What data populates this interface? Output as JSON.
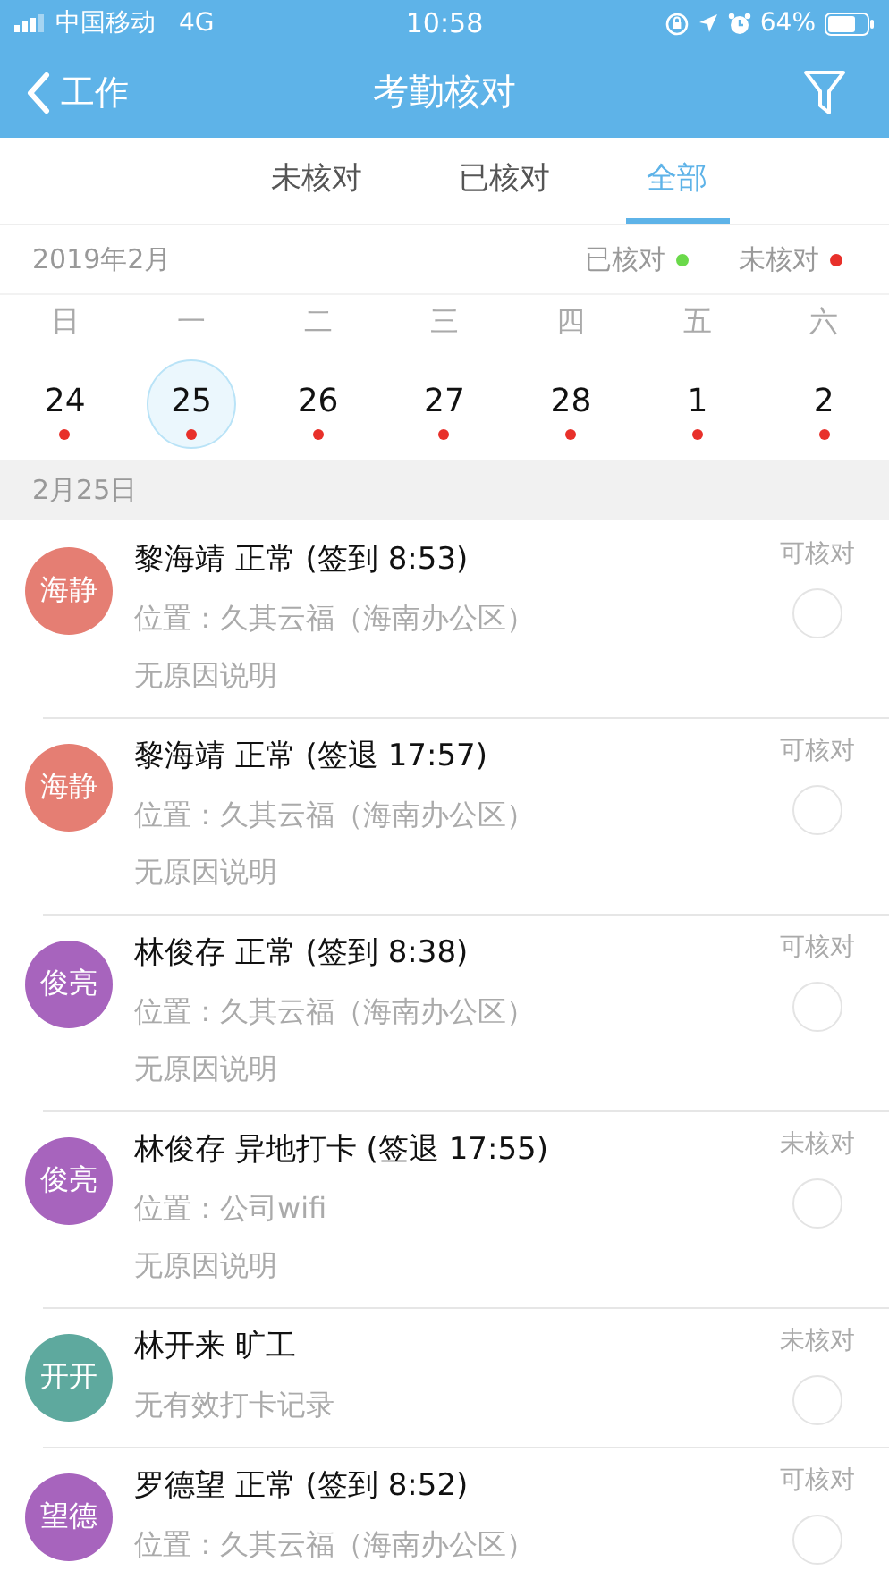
{
  "status_bar": {
    "carrier": "中国移动",
    "network": "4G",
    "time": "10:58",
    "battery": "64%"
  },
  "nav": {
    "back": "工作",
    "title": "考勤核对"
  },
  "tabs": [
    {
      "label": "未核对",
      "selected": false
    },
    {
      "label": "已核对",
      "selected": false
    },
    {
      "label": "全部",
      "selected": true
    }
  ],
  "calendar": {
    "month": "2019年2月",
    "legend": [
      {
        "label": "已核对",
        "color": "#6ad94a"
      },
      {
        "label": "未核对",
        "color": "#e8302a"
      }
    ],
    "weekdays": [
      "日",
      "一",
      "二",
      "三",
      "四",
      "五",
      "六"
    ],
    "days": [
      {
        "label": "24",
        "selected": false,
        "color": "#e8302a"
      },
      {
        "label": "25",
        "selected": true,
        "color": "#e8302a"
      },
      {
        "label": "26",
        "selected": false,
        "color": "#e8302a"
      },
      {
        "label": "27",
        "selected": false,
        "color": "#e8302a"
      },
      {
        "label": "28",
        "selected": false,
        "color": "#e8302a"
      },
      {
        "label": "1",
        "selected": false,
        "color": "#e8302a"
      },
      {
        "label": "2",
        "selected": false,
        "color": "#e8302a"
      }
    ]
  },
  "date_header": "2月25日",
  "records": [
    {
      "avatar": "海静",
      "color": "#e57e73",
      "title": "黎海靖 正常 (签到 8:53)",
      "lines": [
        "位置：久其云福（海南办公区）",
        "无原因说明"
      ],
      "status": "可核对",
      "checked": false
    },
    {
      "avatar": "海静",
      "color": "#e57e73",
      "title": "黎海靖 正常 (签退 17:57)",
      "lines": [
        "位置：久其云福（海南办公区）",
        "无原因说明"
      ],
      "status": "可核对",
      "checked": false
    },
    {
      "avatar": "俊亮",
      "color": "#a764bd",
      "title": "林俊存 正常 (签到 8:38)",
      "lines": [
        "位置：久其云福（海南办公区）",
        "无原因说明"
      ],
      "status": "可核对",
      "checked": false
    },
    {
      "avatar": "俊亮",
      "color": "#a764bd",
      "title": "林俊存 异地打卡 (签退 17:55)",
      "lines": [
        "位置：公司wifi",
        "无原因说明"
      ],
      "status": "未核对",
      "checked": false
    },
    {
      "avatar": "开开",
      "color": "#5ea99e",
      "title": "林开来 旷工",
      "lines": [
        "无有效打卡记录"
      ],
      "status": "未核对",
      "checked": false
    },
    {
      "avatar": "望德",
      "color": "#a764bd",
      "title": "罗德望 正常 (签到 8:52)",
      "lines": [
        "位置：久其云福（海南办公区）"
      ],
      "status": "可核对",
      "checked": false
    }
  ]
}
